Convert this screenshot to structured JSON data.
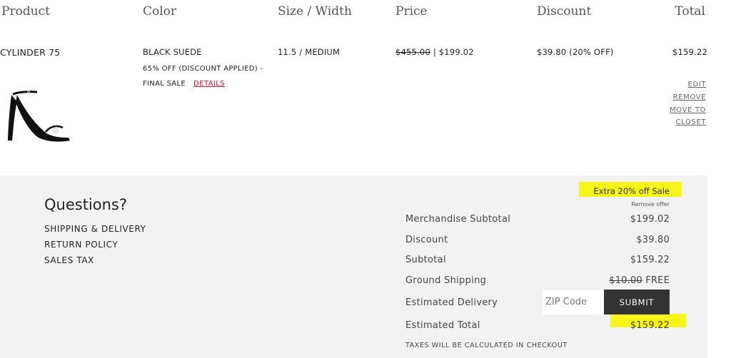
{
  "headers": {
    "product": "Product",
    "color": "Color",
    "size": "Size / Width",
    "price": "Price",
    "discount": "Discount",
    "total": "Total"
  },
  "item": {
    "name": "CYLINDER 75",
    "image_icon": "sandal-image",
    "color": "BLACK SUEDE",
    "note_line1": "65% OFF (DISCOUNT APPLIED) -",
    "note_line2": "FINAL SALE",
    "details_label": "DETAILS",
    "size": "11.5 / MEDIUM",
    "original_price": "$455.00",
    "price_separator": "|",
    "sale_price": "$199.02",
    "discount": "$39.80 (20% OFF)",
    "total": "$159.22",
    "actions": {
      "edit": "EDIT",
      "remove": "REMOVE",
      "move_line1": "MOVE TO",
      "move_line2": "CLOSET"
    }
  },
  "questions": {
    "title": "Questions?",
    "links": [
      "SHIPPING & DELIVERY",
      "RETURN POLICY",
      "SALES TAX"
    ]
  },
  "summary": {
    "offer_title": "Extra 20% off Sale",
    "remove_offer": "Remove offer",
    "merch_subtotal_label": "Merchandise Subtotal",
    "merch_subtotal": "$199.02",
    "discount_label": "Discount",
    "discount": "$39.80",
    "subtotal_label": "Subtotal",
    "subtotal": "$159.22",
    "shipping_label": "Ground Shipping",
    "shipping_original": "$10.00",
    "shipping_value": "FREE",
    "delivery_label": "Estimated Delivery",
    "zip_placeholder": "ZIP Code",
    "submit_label": "SUBMIT",
    "estimated_total_label": "Estimated Total",
    "estimated_total": "$159.22",
    "tax_note": "TAXES WILL BE CALCULATED IN CHECKOUT"
  },
  "colors": {
    "highlight": "#f6f51a",
    "panel_bg": "#f2f2f2",
    "button_bg": "#333333",
    "link_red": "#c8102e"
  }
}
